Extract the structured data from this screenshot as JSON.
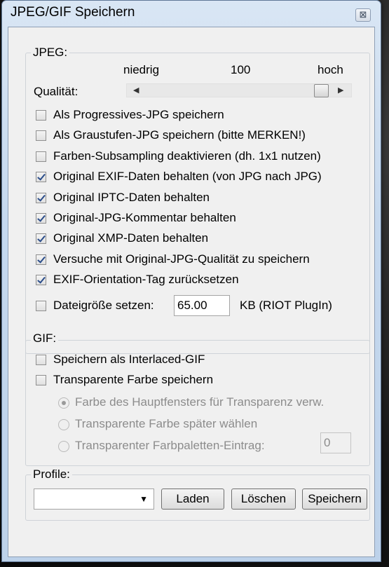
{
  "window": {
    "title": "JPEG/GIF Speichern",
    "close_glyph": "⊠"
  },
  "jpeg": {
    "group_label": "JPEG:",
    "quality_label": "Qualität:",
    "low_label": "niedrig",
    "high_label": "hoch",
    "quality_value": "100",
    "quality_fraction": 1.0,
    "checkboxes": [
      {
        "label": "Als Progressives-JPG speichern",
        "checked": false
      },
      {
        "label": "Als Graustufen-JPG speichern (bitte MERKEN!)",
        "checked": false
      },
      {
        "label": "Farben-Subsampling deaktivieren (dh. 1x1 nutzen)",
        "checked": false
      },
      {
        "label": "Original EXIF-Daten behalten (von JPG nach JPG)",
        "checked": true
      },
      {
        "label": "Original IPTC-Daten behalten",
        "checked": true
      },
      {
        "label": "Original-JPG-Kommentar behalten",
        "checked": true
      },
      {
        "label": "Original XMP-Daten behalten",
        "checked": true
      },
      {
        "label": "Versuche mit Original-JPG-Qualität zu speichern",
        "checked": true
      },
      {
        "label": "EXIF-Orientation-Tag zurücksetzen",
        "checked": true
      }
    ],
    "filesize": {
      "label": "Dateigröße setzen:",
      "checked": false,
      "value": "65.00",
      "unit": "KB (RIOT PlugIn)"
    }
  },
  "gif": {
    "group_label": "GIF:",
    "checkboxes": [
      {
        "label": "Speichern als Interlaced-GIF",
        "checked": false
      },
      {
        "label": "Transparente Farbe speichern",
        "checked": false
      }
    ],
    "radios": [
      {
        "label": "Farbe des Hauptfensters für Transparenz verw.",
        "selected": true
      },
      {
        "label": "Transparente Farbe später wählen",
        "selected": false
      },
      {
        "label": "Transparenter Farbpaletten-Eintrag:",
        "selected": false
      }
    ],
    "palette_entry_value": "0"
  },
  "profile": {
    "group_label": "Profile:",
    "selected": "",
    "load_label": "Laden",
    "delete_label": "Löschen",
    "save_label": "Speichern"
  }
}
